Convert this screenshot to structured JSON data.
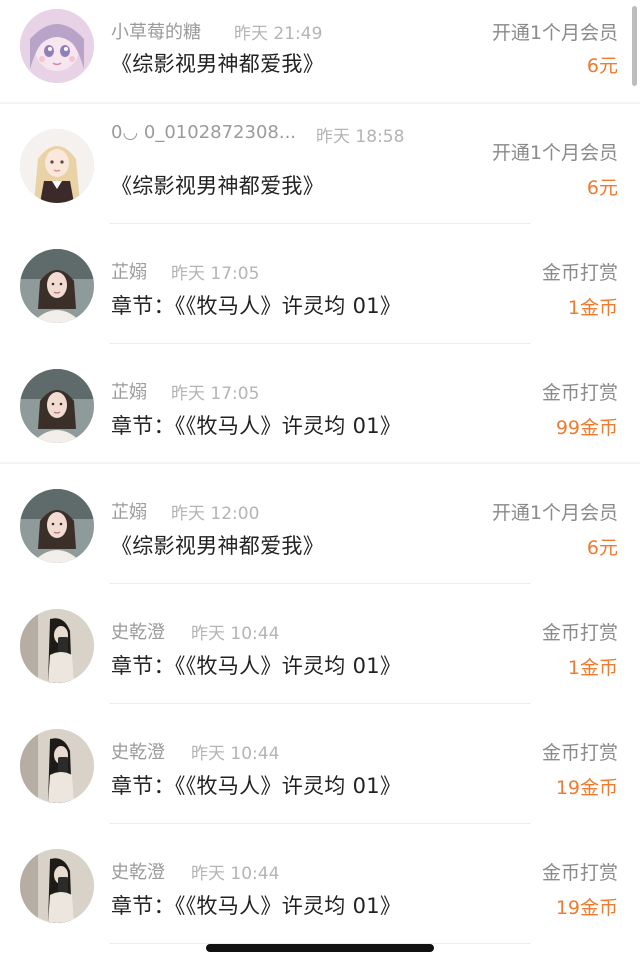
{
  "records": [
    {
      "name": "小草莓的糖",
      "time": "昨天 21:49",
      "title": "《综影视男神都爱我》",
      "type": "开通1个月会员",
      "amount": "6元",
      "avatar": "anime-girl-avatar"
    },
    {
      "name": "0◡ 0_0102872308...",
      "time": "昨天 18:58",
      "title": "《综影视男神都爱我》",
      "type": "开通1个月会员",
      "amount": "6元",
      "avatar": "blonde-girl-avatar"
    },
    {
      "name": "芷嫋",
      "time": "昨天 17:05",
      "title": "章节：《《牧马人》许灵均 01》",
      "type": "金币打赏",
      "amount": "1金币",
      "avatar": "woman-portrait-avatar"
    },
    {
      "name": "芷嫋",
      "time": "昨天 17:05",
      "title": "章节：《《牧马人》许灵均 01》",
      "type": "金币打赏",
      "amount": "99金币",
      "avatar": "woman-portrait-avatar"
    },
    {
      "name": "芷嫋",
      "time": "昨天 12:00",
      "title": "《综影视男神都爱我》",
      "type": "开通1个月会员",
      "amount": "6元",
      "avatar": "woman-portrait-avatar"
    },
    {
      "name": "史乾澄",
      "time": "昨天 10:44",
      "title": "章节：《《牧马人》许灵均 01》",
      "type": "金币打赏",
      "amount": "1金币",
      "avatar": "mirror-selfie-avatar"
    },
    {
      "name": "史乾澄",
      "time": "昨天 10:44",
      "title": "章节：《《牧马人》许灵均 01》",
      "type": "金币打赏",
      "amount": "19金币",
      "avatar": "mirror-selfie-avatar"
    },
    {
      "name": "史乾澄",
      "time": "昨天 10:44",
      "title": "章节：《《牧马人》许灵均 01》",
      "type": "金币打赏",
      "amount": "19金币",
      "avatar": "mirror-selfie-avatar"
    }
  ],
  "colors": {
    "amount": "#f07a2f",
    "name": "#9b9b9b",
    "time": "#b4b4b4",
    "title": "#222222",
    "type": "#8a8a8a"
  }
}
